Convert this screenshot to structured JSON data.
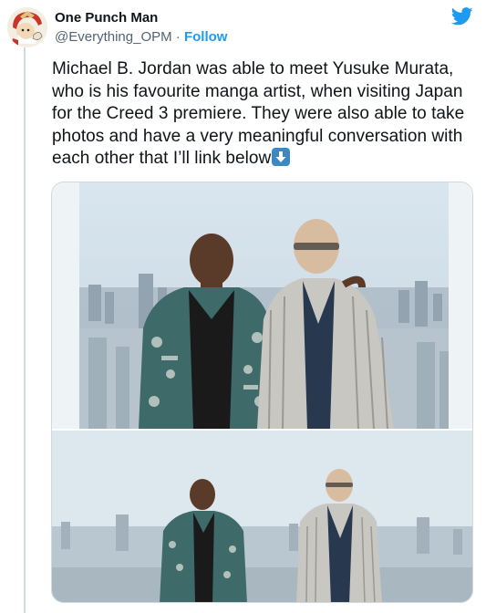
{
  "account": {
    "display_name": "One Punch Man",
    "handle": "@Everything_OPM",
    "separator": " · ",
    "follow_label": "Follow",
    "avatar_icon": "onepunch-avatar-icon"
  },
  "platform": {
    "logo_icon": "twitter-bird-icon",
    "brand_color": "#1d9bf0"
  },
  "tweet": {
    "text": "Michael B. Jordan was able to meet Yusuke Murata, who is his favourite manga artist, when visiting Japan for the Creed 3 premiere. They were also able to take photos and have a very meaningful conversation with each other that I’ll link below",
    "emoji": "down-arrow-emoji"
  },
  "media": {
    "photos": [
      {
        "name": "photo-1",
        "subject": "two men posing in front of city skyline"
      },
      {
        "name": "photo-2",
        "subject": "two men standing apart in front of city skyline"
      }
    ]
  }
}
